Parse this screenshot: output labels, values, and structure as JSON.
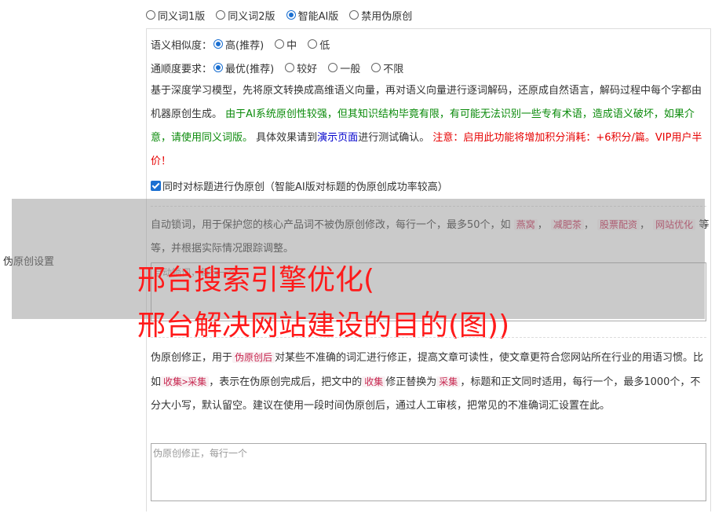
{
  "top_modes": {
    "options": [
      "同义词1版",
      "同义词2版",
      "智能AI版",
      "禁用伪原创"
    ],
    "selected": "智能AI版"
  },
  "similarity": {
    "label": "语义相似度：",
    "options": [
      "高(推荐)",
      "中",
      "低"
    ],
    "selected": "高(推荐)"
  },
  "fluency": {
    "label": "通顺度要求：",
    "options": [
      "最优(推荐)",
      "较好",
      "一般",
      "不限"
    ],
    "selected": "最优(推荐)"
  },
  "description": {
    "text1": "基于深度学习模型，先将原文转换成高维语义向量，再对语义向量进行逐词解码，还原成自然语言，解码过程中每个字都由机器原创生成。",
    "green": "由于AI系统原创性较强，但其知识结构毕竟有限，有可能无法识别一些专有术语，造成语义破坏，如果介意，请使用同义词版。",
    "text2": "具体效果请到",
    "link": "演示页面",
    "text3": "进行测试确认。",
    "red": "注意：启用此功能将增加积分消耗：+6积分/篇。VIP用户半价！"
  },
  "title_checkbox": {
    "label": "同时对标题进行伪原创（智能AI版对标题的伪原创成功率较高）",
    "checked": true
  },
  "lock_words": {
    "text1": "自动锁词，用于保护您的核心产品词不被伪原创修改，每行一个，最多50个，如",
    "chips": [
      "燕窝",
      "减肥茶",
      "股票配资",
      "网站优化"
    ],
    "text2": "等等，并根据实际情况跟踪调整。",
    "placeholder": "自动锁词，每行一个"
  },
  "correction": {
    "text1": "伪原创修正，用于",
    "chip1": "伪原创后",
    "text2": "对某些不准确的词汇进行修正，提高文章可读性，使文章更符合您网站所在行业的用语习惯。比如",
    "chip2": "收集>采集",
    "text3": "，表示在伪原创完成后，把文中的",
    "chip3": "收集",
    "text4": "修正替换为",
    "chip4": "采集",
    "text5": "，标题和正文同时适用，每行一个，最多1000个，不分大小写，默认留空。建议在使用一段时间伪原创后，通过人工审核，把常见的不准确词汇设置在此。",
    "placeholder": "伪原创修正，每行一个"
  },
  "side_label": "伪原创设置",
  "watermark": {
    "line1": "邢台搜索引擎优化(",
    "line2": "邢台解决网站建设的目的(图))"
  },
  "colors": {
    "accent": "#1a6fd1",
    "green": "#0a8a0a",
    "red": "#e60000",
    "watermark": "#ff1a1a"
  }
}
